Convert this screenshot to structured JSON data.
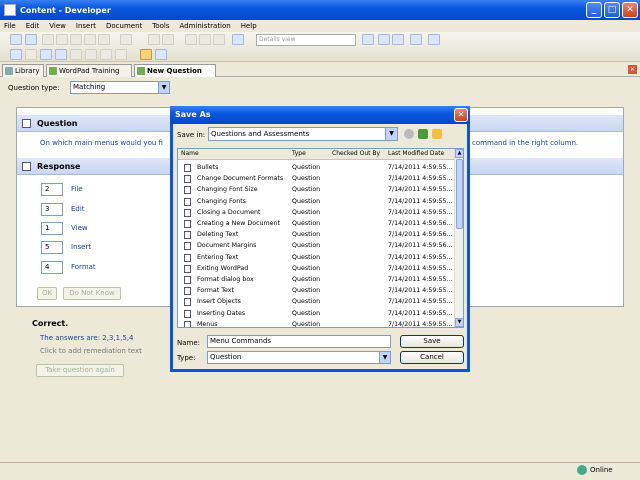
{
  "window": {
    "title": "Content - Developer"
  },
  "menu": [
    "File",
    "Edit",
    "View",
    "Insert",
    "Document",
    "Tools",
    "Administration",
    "Help"
  ],
  "toolbar": {
    "view_select": "Details view"
  },
  "tabs": [
    {
      "label": "Library"
    },
    {
      "label": "WordPad Training"
    },
    {
      "label": "New Question"
    }
  ],
  "question_type": {
    "label": "Question type:",
    "value": "Matching"
  },
  "question": {
    "header": "Question",
    "text": "On which main menus would you fi",
    "text_tail": "command in the right column."
  },
  "response": {
    "header": "Response",
    "rows": [
      {
        "num": "2",
        "label": "File"
      },
      {
        "num": "3",
        "label": "Edit"
      },
      {
        "num": "1",
        "label": "View"
      },
      {
        "num": "5",
        "label": "Insert"
      },
      {
        "num": "4",
        "label": "Format"
      }
    ],
    "ok": "OK",
    "dont_know": "Do Not Know"
  },
  "feedback": {
    "correct": "Correct.",
    "answers": "The answers are: 2,3,1,5,4",
    "remediation": "Click to add remediation text",
    "retake": "Take question again"
  },
  "status": {
    "online": "Online"
  },
  "dialog": {
    "title": "Save As",
    "save_in_label": "Save in:",
    "save_in_value": "Questions and Assessments",
    "columns": [
      "Name",
      "Type",
      "Checked Out By",
      "Last Modified Date"
    ],
    "files": [
      {
        "name": "Bullets",
        "type": "Question",
        "checked": "",
        "date": "7/14/2011 4:59:55..."
      },
      {
        "name": "Change Document Formats",
        "type": "Question",
        "checked": "",
        "date": "7/14/2011 4:59:55..."
      },
      {
        "name": "Changing Font Size",
        "type": "Question",
        "checked": "",
        "date": "7/14/2011 4:59:55..."
      },
      {
        "name": "Changing Fonts",
        "type": "Question",
        "checked": "",
        "date": "7/14/2011 4:59:55..."
      },
      {
        "name": "Closing a Document",
        "type": "Question",
        "checked": "",
        "date": "7/14/2011 4:59:55..."
      },
      {
        "name": "Creating a New Document",
        "type": "Question",
        "checked": "",
        "date": "7/14/2011 4:59:56..."
      },
      {
        "name": "Deleting Text",
        "type": "Question",
        "checked": "",
        "date": "7/14/2011 4:59:56..."
      },
      {
        "name": "Document Margins",
        "type": "Question",
        "checked": "",
        "date": "7/14/2011 4:59:56..."
      },
      {
        "name": "Entering Text",
        "type": "Question",
        "checked": "",
        "date": "7/14/2011 4:59:55..."
      },
      {
        "name": "Exiting WordPad",
        "type": "Question",
        "checked": "",
        "date": "7/14/2011 4:59:55..."
      },
      {
        "name": "Format dialog box",
        "type": "Question",
        "checked": "",
        "date": "7/14/2011 4:59:55..."
      },
      {
        "name": "Format Text",
        "type": "Question",
        "checked": "",
        "date": "7/14/2011 4:59:55..."
      },
      {
        "name": "Insert Objects",
        "type": "Question",
        "checked": "",
        "date": "7/14/2011 4:59:55..."
      },
      {
        "name": "Inserting Dates",
        "type": "Question",
        "checked": "",
        "date": "7/14/2011 4:59:55..."
      },
      {
        "name": "Menus",
        "type": "Question",
        "checked": "",
        "date": "7/14/2011 4:59:55..."
      }
    ],
    "name_label": "Name:",
    "name_value": "Menu Commands",
    "type_label": "Type:",
    "type_value": "Question",
    "save": "Save",
    "cancel": "Cancel"
  }
}
